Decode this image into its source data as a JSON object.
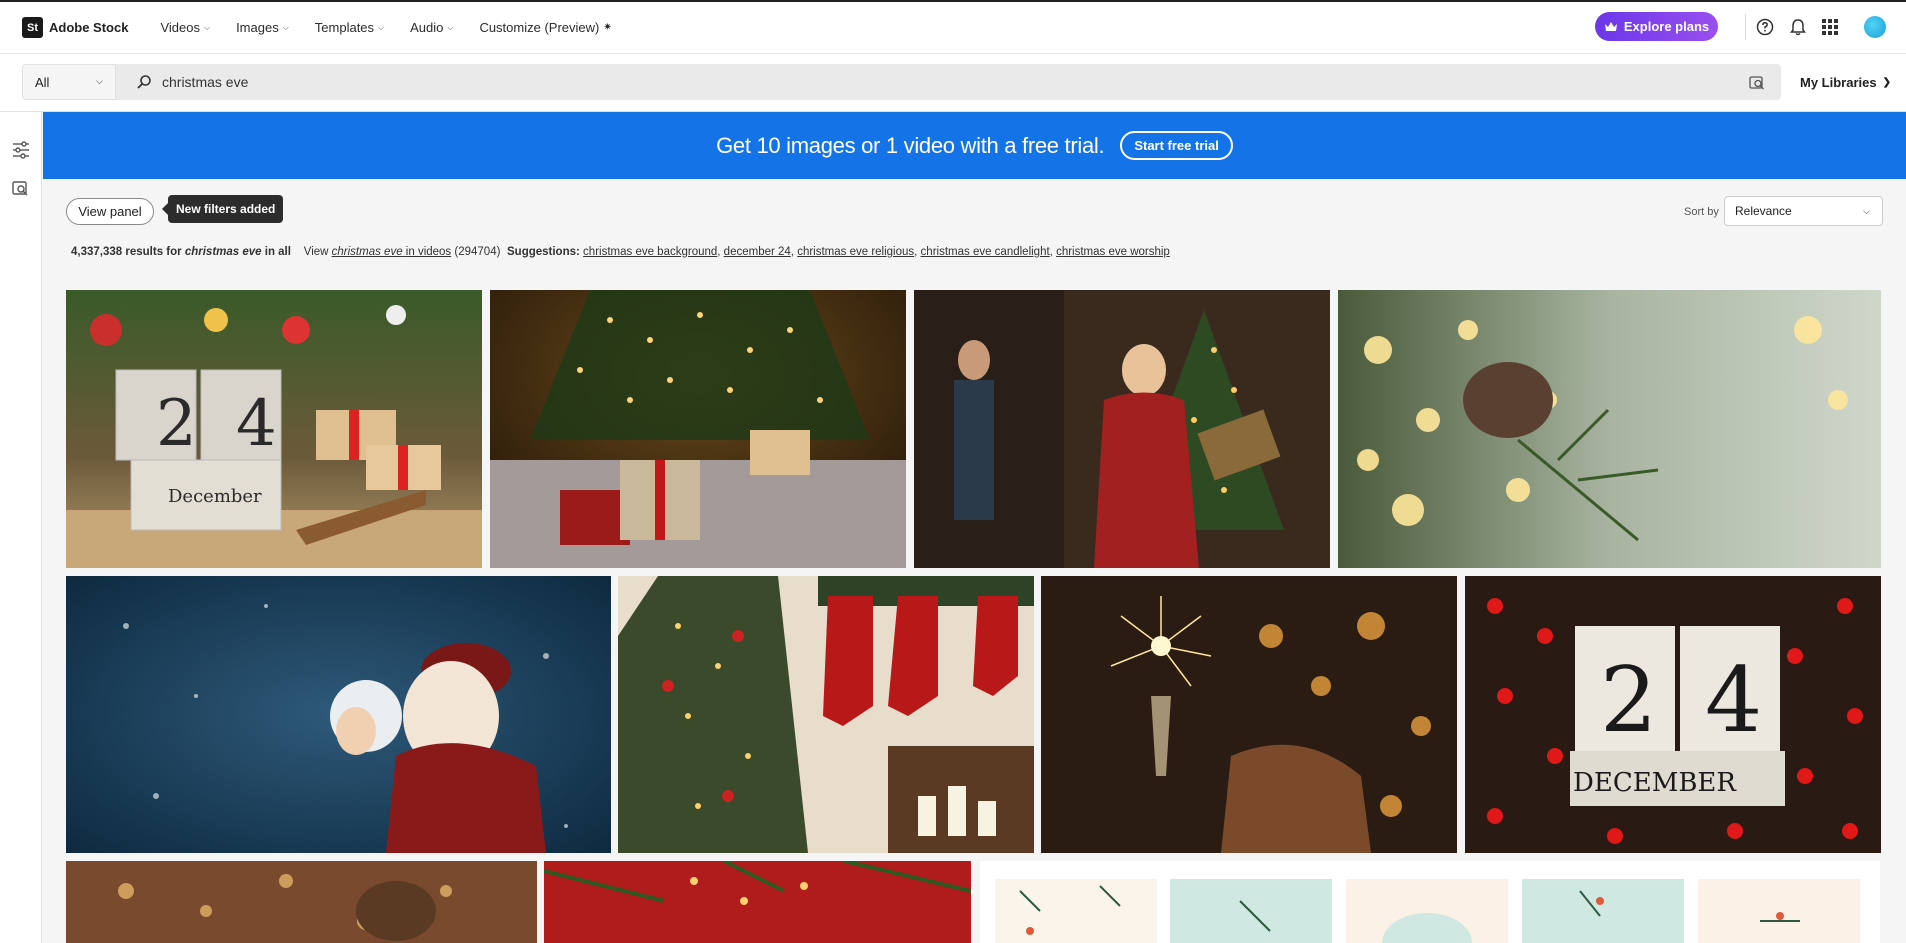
{
  "brand": {
    "logo": "St",
    "name": "Adobe Stock"
  },
  "nav": [
    {
      "label": "Videos"
    },
    {
      "label": "Images"
    },
    {
      "label": "Templates"
    },
    {
      "label": "Audio"
    },
    {
      "label": "Customize (Preview)"
    }
  ],
  "header": {
    "explore_label": "Explore plans",
    "icons": [
      "help-icon",
      "bell-icon",
      "apps-grid-icon",
      "avatar"
    ]
  },
  "search": {
    "filter_value": "All",
    "query": "christmas eve",
    "my_libraries": "My Libraries"
  },
  "banner": {
    "text": "Get 10 images or 1 video with a free trial.",
    "cta": "Start free trial"
  },
  "controls": {
    "view_panel": "View panel",
    "tooltip": "New filters added",
    "sort_label": "Sort by",
    "sort_value": "Relevance"
  },
  "results": {
    "count": "4,337,338",
    "text_for": "results for",
    "query": "christmas eve",
    "text_in_all": "in all",
    "view_prefix": "View",
    "video_query": "christmas eve",
    "video_suffix": "in videos",
    "video_count": "(294704)",
    "suggestions_label": "Suggestions:",
    "suggestions": [
      "christmas eve background",
      "december 24",
      "christmas eve religious",
      "christmas eve candlelight",
      "christmas eve worship"
    ]
  },
  "images": [
    {
      "desc": "calendar-blocks-24-december",
      "numbers": "2 4",
      "caption": "December"
    },
    {
      "desc": "gifts-under-tree"
    },
    {
      "desc": "people-exchanging-gifts"
    },
    {
      "desc": "pine-cone-bokeh"
    },
    {
      "desc": "santa-claus-snow"
    },
    {
      "desc": "stockings-fireplace"
    },
    {
      "desc": "sparklers-toast"
    },
    {
      "desc": "december-24-calendar-lights",
      "numbers": "2 4",
      "caption": "DECEMBER"
    },
    {
      "desc": "pinecone-golden-bokeh"
    },
    {
      "desc": "red-fabric-fir-branches"
    },
    {
      "desc": "pattern-cards"
    }
  ]
}
